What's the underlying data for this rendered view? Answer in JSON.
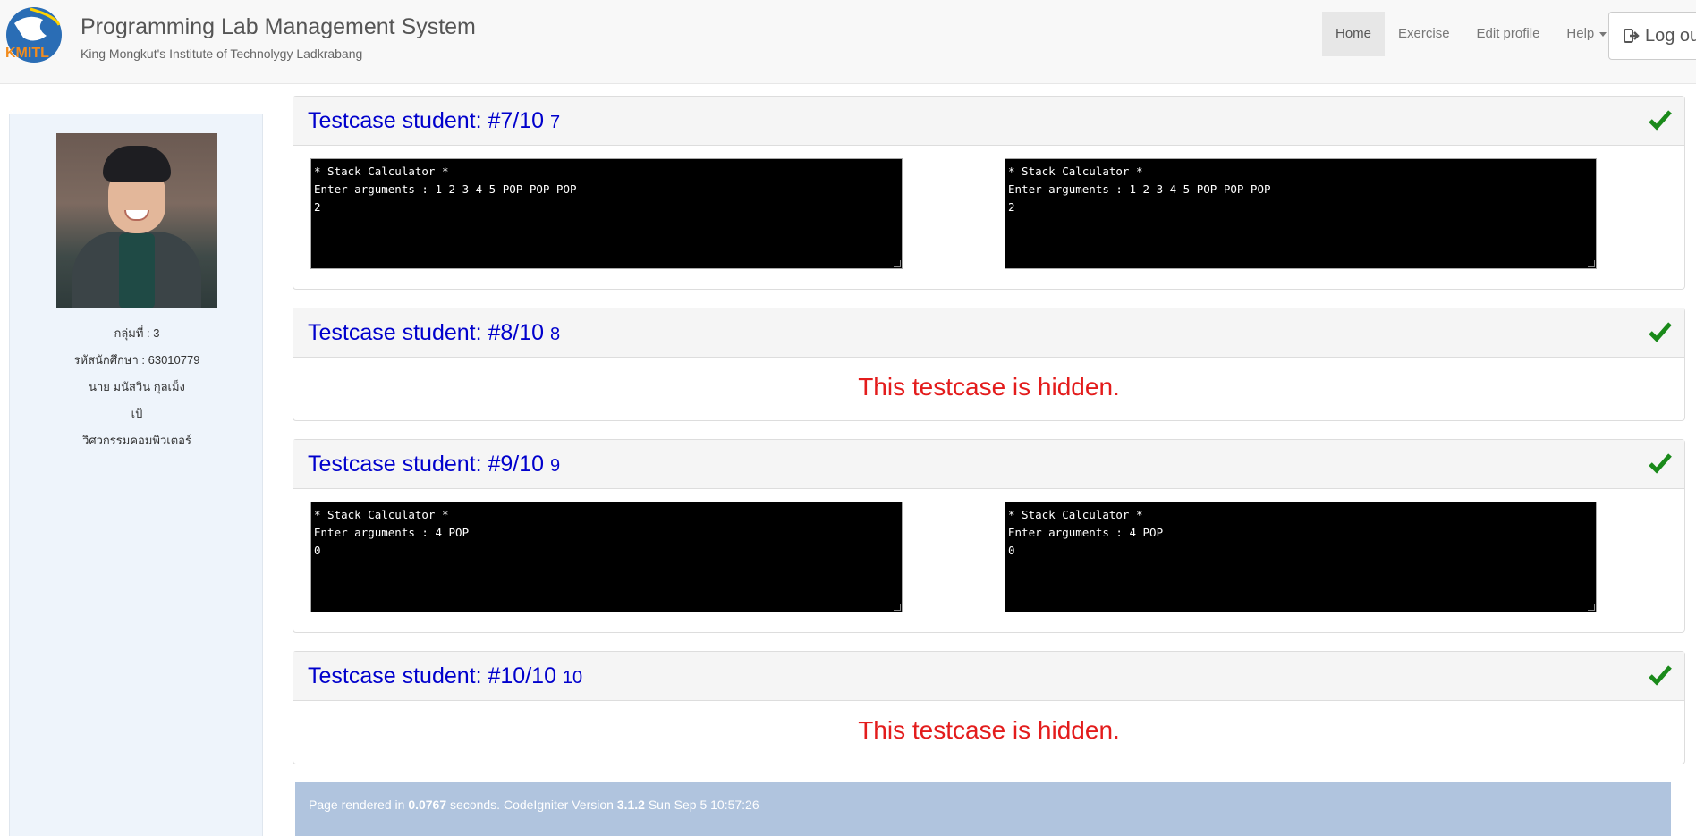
{
  "header": {
    "title": "Programming Lab Management System",
    "subtitle": "King Mongkut's Institute of Technolygy Ladkrabang",
    "logo_text": "KMITL",
    "nav": [
      "Home",
      "Exercise",
      "Edit profile",
      "Help"
    ],
    "logout_label": "Log out"
  },
  "sidebar": {
    "group": "กลุ่มที่ : 3",
    "student_id": "รหัสนักศึกษา : 63010779",
    "name": "นาย มนัสวิน กุลเม็ง",
    "nickname": "เป้",
    "faculty": "วิศวกรรมคอมพิวเตอร์"
  },
  "testcases": [
    {
      "title": "Testcase student: #7/10",
      "number": "7",
      "passed": true,
      "hidden": false,
      "expected": "* Stack Calculator *\nEnter arguments : 1 2 3 4 5 POP POP POP\n2",
      "actual": "* Stack Calculator *\nEnter arguments : 1 2 3 4 5 POP POP POP\n2"
    },
    {
      "title": "Testcase student: #8/10",
      "number": "8",
      "passed": true,
      "hidden": true,
      "hidden_text": "This testcase is hidden."
    },
    {
      "title": "Testcase student: #9/10",
      "number": "9",
      "passed": true,
      "hidden": false,
      "expected": "* Stack Calculator *\nEnter arguments : 4 POP\n0",
      "actual": "* Stack Calculator *\nEnter arguments : 4 POP\n0"
    },
    {
      "title": "Testcase student: #10/10",
      "number": "10",
      "passed": true,
      "hidden": true,
      "hidden_text": "This testcase is hidden."
    }
  ],
  "footer": {
    "prefix": "Page rendered in ",
    "seconds": "0.0767",
    "middle": " seconds. CodeIgniter Version ",
    "version": "3.1.2",
    "timestamp": " Sun Sep 5 10:57:26"
  },
  "colors": {
    "title_blue": "#0000cc",
    "hidden_red": "#e31c1c",
    "check_green": "#1a8a1a",
    "footer_bg": "#b0c4de",
    "sidebar_bg": "#eef4fb"
  },
  "icons": {
    "check": "check-icon",
    "logout": "logout-icon",
    "caret": "caret-down-icon"
  }
}
